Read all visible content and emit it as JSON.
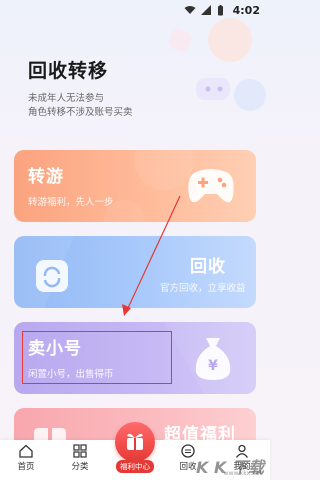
{
  "status_bar": {
    "time": "4:02"
  },
  "header": {
    "title": "回收转移",
    "notes": [
      "未成年人无法参与",
      "角色转移不涉及账号买卖"
    ]
  },
  "cards": [
    {
      "title": "转游",
      "desc": "转游福利，先人一步",
      "icon": "gamepad-icon"
    },
    {
      "title": "回收",
      "desc": "官方回收，立享收益",
      "icon": "recycle-bag-icon"
    },
    {
      "title": "卖小号",
      "desc": "闲置小号，出售得币",
      "icon": "money-bag-icon"
    },
    {
      "title": "超值福利",
      "desc": "",
      "icon": "gift-icon"
    }
  ],
  "tabbar": {
    "items": [
      {
        "label": "首页",
        "icon": "home-icon"
      },
      {
        "label": "分类",
        "icon": "grid-icon"
      },
      {
        "label": "福利中心",
        "icon": "gift-center-icon"
      },
      {
        "label": "回收",
        "icon": "recycle-icon"
      },
      {
        "label": "我的",
        "icon": "profile-icon"
      }
    ]
  },
  "watermark": {
    "text": "K K 下载",
    "sub": "www.kkx.net"
  },
  "colors": {
    "accent_red": "#e53935",
    "card_orange": "#fba37f",
    "card_blue": "#93b9f5",
    "card_purple": "#b9a8ef"
  }
}
